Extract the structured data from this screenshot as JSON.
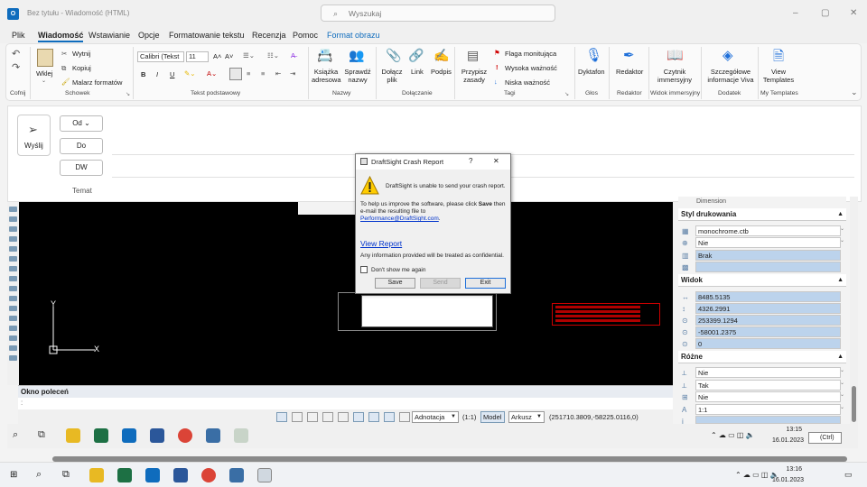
{
  "window": {
    "title": "Bez tytułu  -  Wiadomość (HTML)",
    "search_placeholder": "Wyszukaj",
    "controls": [
      "–",
      "▢",
      "✕"
    ]
  },
  "menu": [
    {
      "label": "Plik"
    },
    {
      "label": "Wiadomość",
      "active": true
    },
    {
      "label": "Wstawianie"
    },
    {
      "label": "Opcje"
    },
    {
      "label": "Formatowanie tekstu"
    },
    {
      "label": "Recenzja"
    },
    {
      "label": "Pomoc"
    },
    {
      "label": "Format obrazu",
      "accent": true
    }
  ],
  "ribbon": {
    "undo_group": "Cofnij",
    "clipboard": {
      "paste": "Wklej",
      "cut": "Wytnij",
      "copy": "Kopiuj",
      "painter": "Malarz formatów",
      "group": "Schowek"
    },
    "font": {
      "name": "Calibri (Tekst",
      "size": "11",
      "group": "Tekst podstawowy"
    },
    "names": {
      "address_book": "Książka adresowa",
      "check_names": "Sprawdź nazwy",
      "group": "Nazwy"
    },
    "include": {
      "attach": "Dołącz plik",
      "link": "Link",
      "signature": "Podpis",
      "group": "Dołączanie"
    },
    "tags": {
      "assign": "Przypisz zasady",
      "flag": "Flaga monitująca",
      "high": "Wysoka ważność",
      "low": "Niska ważność",
      "group": "Tagi"
    },
    "voice": {
      "dictate": "Dyktafon",
      "group": "Głos"
    },
    "editor": {
      "label": "Redaktor",
      "group": "Redaktor"
    },
    "immersive": {
      "label": "Czytnik immersyjny",
      "group": "Widok immersyjny"
    },
    "addin": {
      "label": "Szczegółowe informacje Viva",
      "group": "Dodatek"
    },
    "templates": {
      "label": "View Templates",
      "group": "My Templates"
    }
  },
  "compose": {
    "send": "Wyślij",
    "from": "Od",
    "to": "Do",
    "cc": "DW",
    "subject": "Temat"
  },
  "dialog": {
    "title": "DraftSight Crash Report",
    "help": "?",
    "close": "✕",
    "message": "DraftSight is unable to send your crash report.",
    "help_text_1": "To help us improve the software, please click ",
    "help_text_bold": "Save",
    "help_text_2": " then e-mail the resulting file to",
    "email": "Performance@DraftSight.com",
    "email_suffix": ".",
    "view_report": "View Report",
    "confidential": "Any information provided will be treated as confidential.",
    "dont_show": "Don't show me again",
    "save": "Save",
    "send": "Send",
    "exit": "Exit"
  },
  "cad": {
    "command_window": "Okno poleceń",
    "cmd_prompt": ":",
    "axis_x": "X",
    "axis_y": "Y",
    "status": {
      "annotation": "Adnotacja",
      "scale": "(1:1)",
      "model": "Model",
      "sheet": "Arkusz",
      "coords": "(251710.3809,-58225.0116,0)"
    },
    "panel": {
      "top_item": "Dimension",
      "print_style": {
        "header": "Styl drukowania",
        "rows": [
          "monochrome.ctb",
          "Nie",
          "Brak",
          ""
        ]
      },
      "view": {
        "header": "Widok",
        "rows": [
          "8485.5135",
          "4326.2991",
          "253399.1294",
          "-58001.2375",
          "0"
        ]
      },
      "misc": {
        "header": "Różne",
        "rows": [
          "Nie",
          "Tak",
          "Nie",
          "1:1",
          ""
        ]
      }
    }
  },
  "taskbar_inner": {
    "time": "13:15",
    "date": "16.01.2023",
    "ctrl": "(Ctrl)"
  },
  "taskbar": {
    "time": "13:16",
    "date": "16.01.2023"
  }
}
